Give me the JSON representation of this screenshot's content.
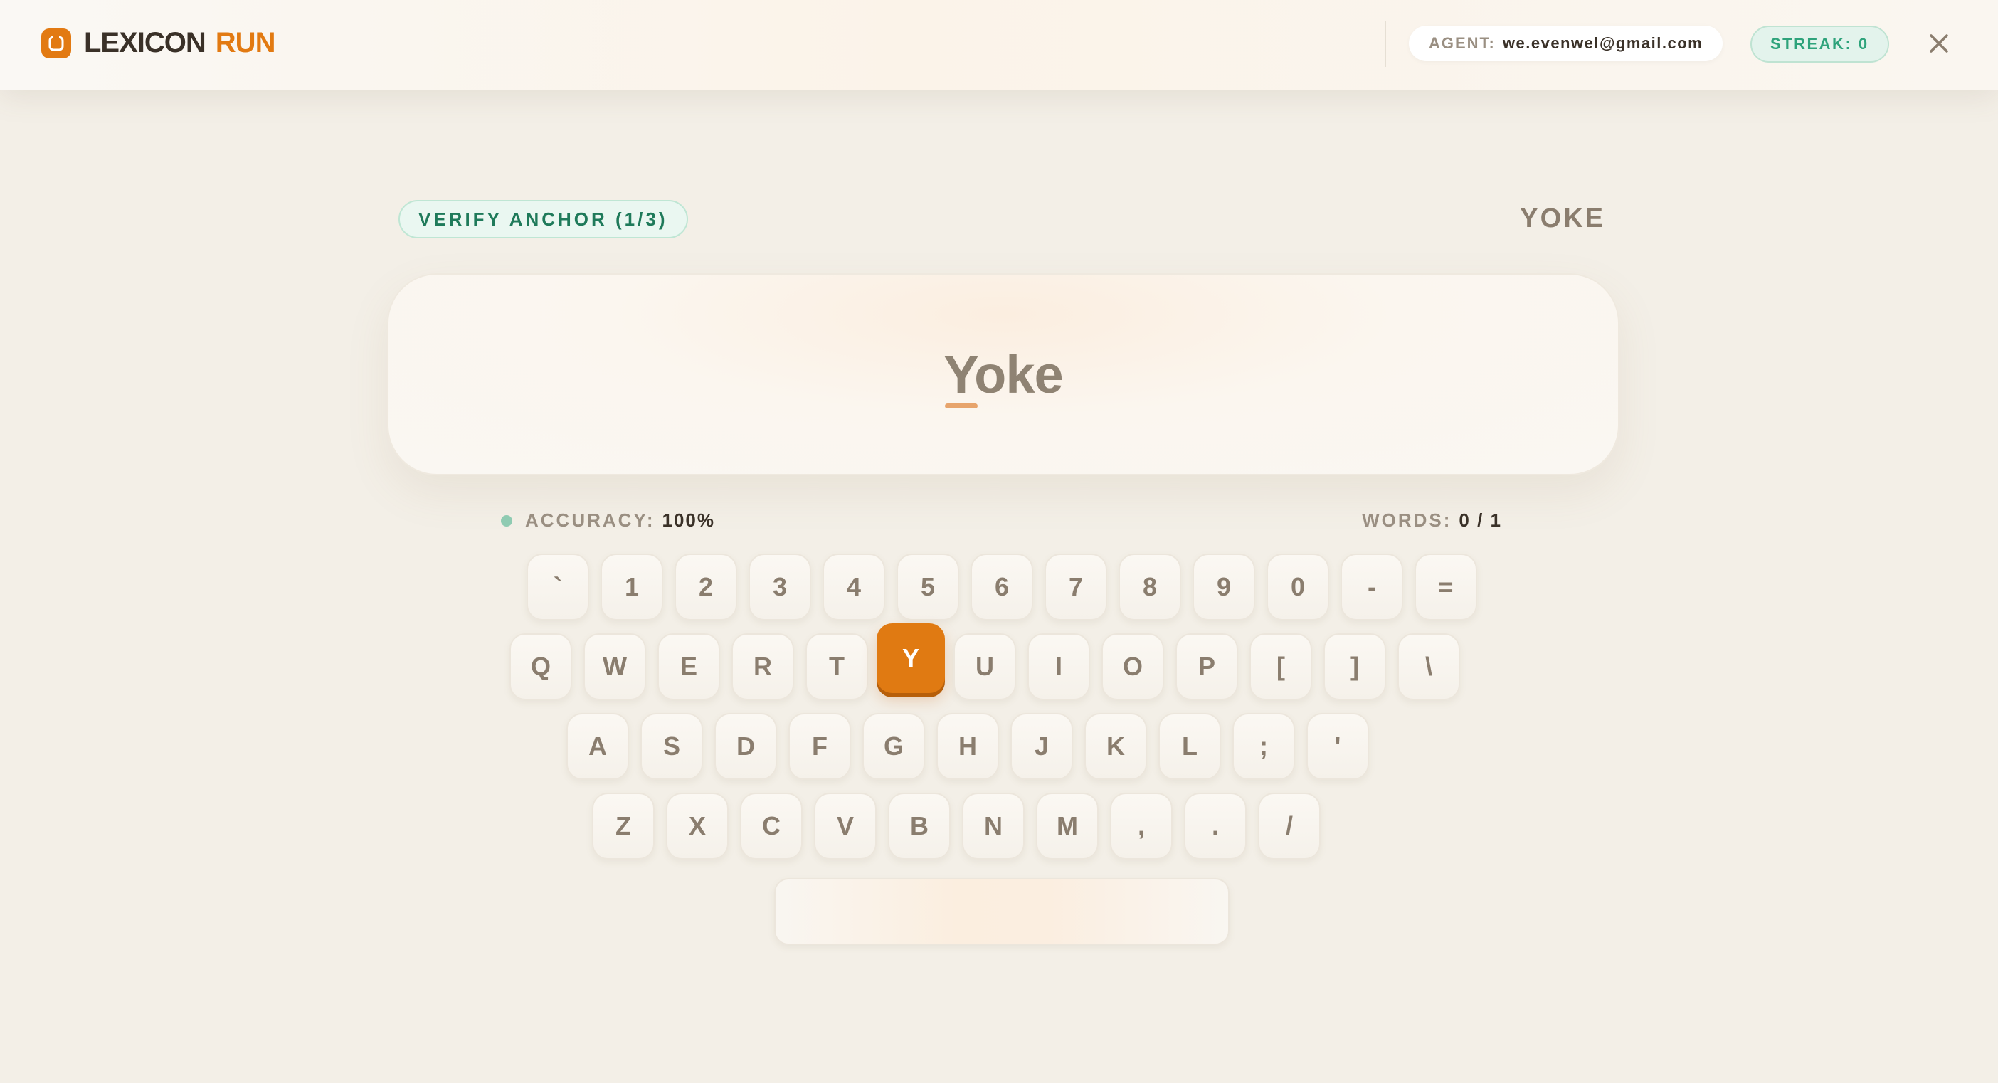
{
  "header": {
    "brand_name": "LEXICON",
    "brand_accent": "RUN",
    "agent_label": "AGENT:",
    "agent_value": "we.evenwel@gmail.com",
    "streak_text": "STREAK: 0"
  },
  "round": {
    "anchor_label": "VERIFY ANCHOR (1/3)",
    "target_word": "YOKE",
    "display_word": "Yoke"
  },
  "stats": {
    "accuracy_label": "ACCURACY:",
    "accuracy_value": "100%",
    "words_label": "WORDS:",
    "words_value": "0 / 1"
  },
  "keyboard": {
    "active_key": "Y",
    "rows": [
      [
        "`",
        "1",
        "2",
        "3",
        "4",
        "5",
        "6",
        "7",
        "8",
        "9",
        "0",
        "-",
        "="
      ],
      [
        "Q",
        "W",
        "E",
        "R",
        "T",
        "Y",
        "U",
        "I",
        "O",
        "P",
        "[",
        "]",
        "\\"
      ],
      [
        "A",
        "S",
        "D",
        "F",
        "G",
        "H",
        "J",
        "K",
        "L",
        ";",
        "'"
      ],
      [
        "Z",
        "X",
        "C",
        "V",
        "B",
        "N",
        "M",
        ",",
        ".",
        "/"
      ]
    ]
  },
  "colors": {
    "accent": "#e27a12",
    "success": "#2ea37b",
    "background": "#f3efe7"
  }
}
